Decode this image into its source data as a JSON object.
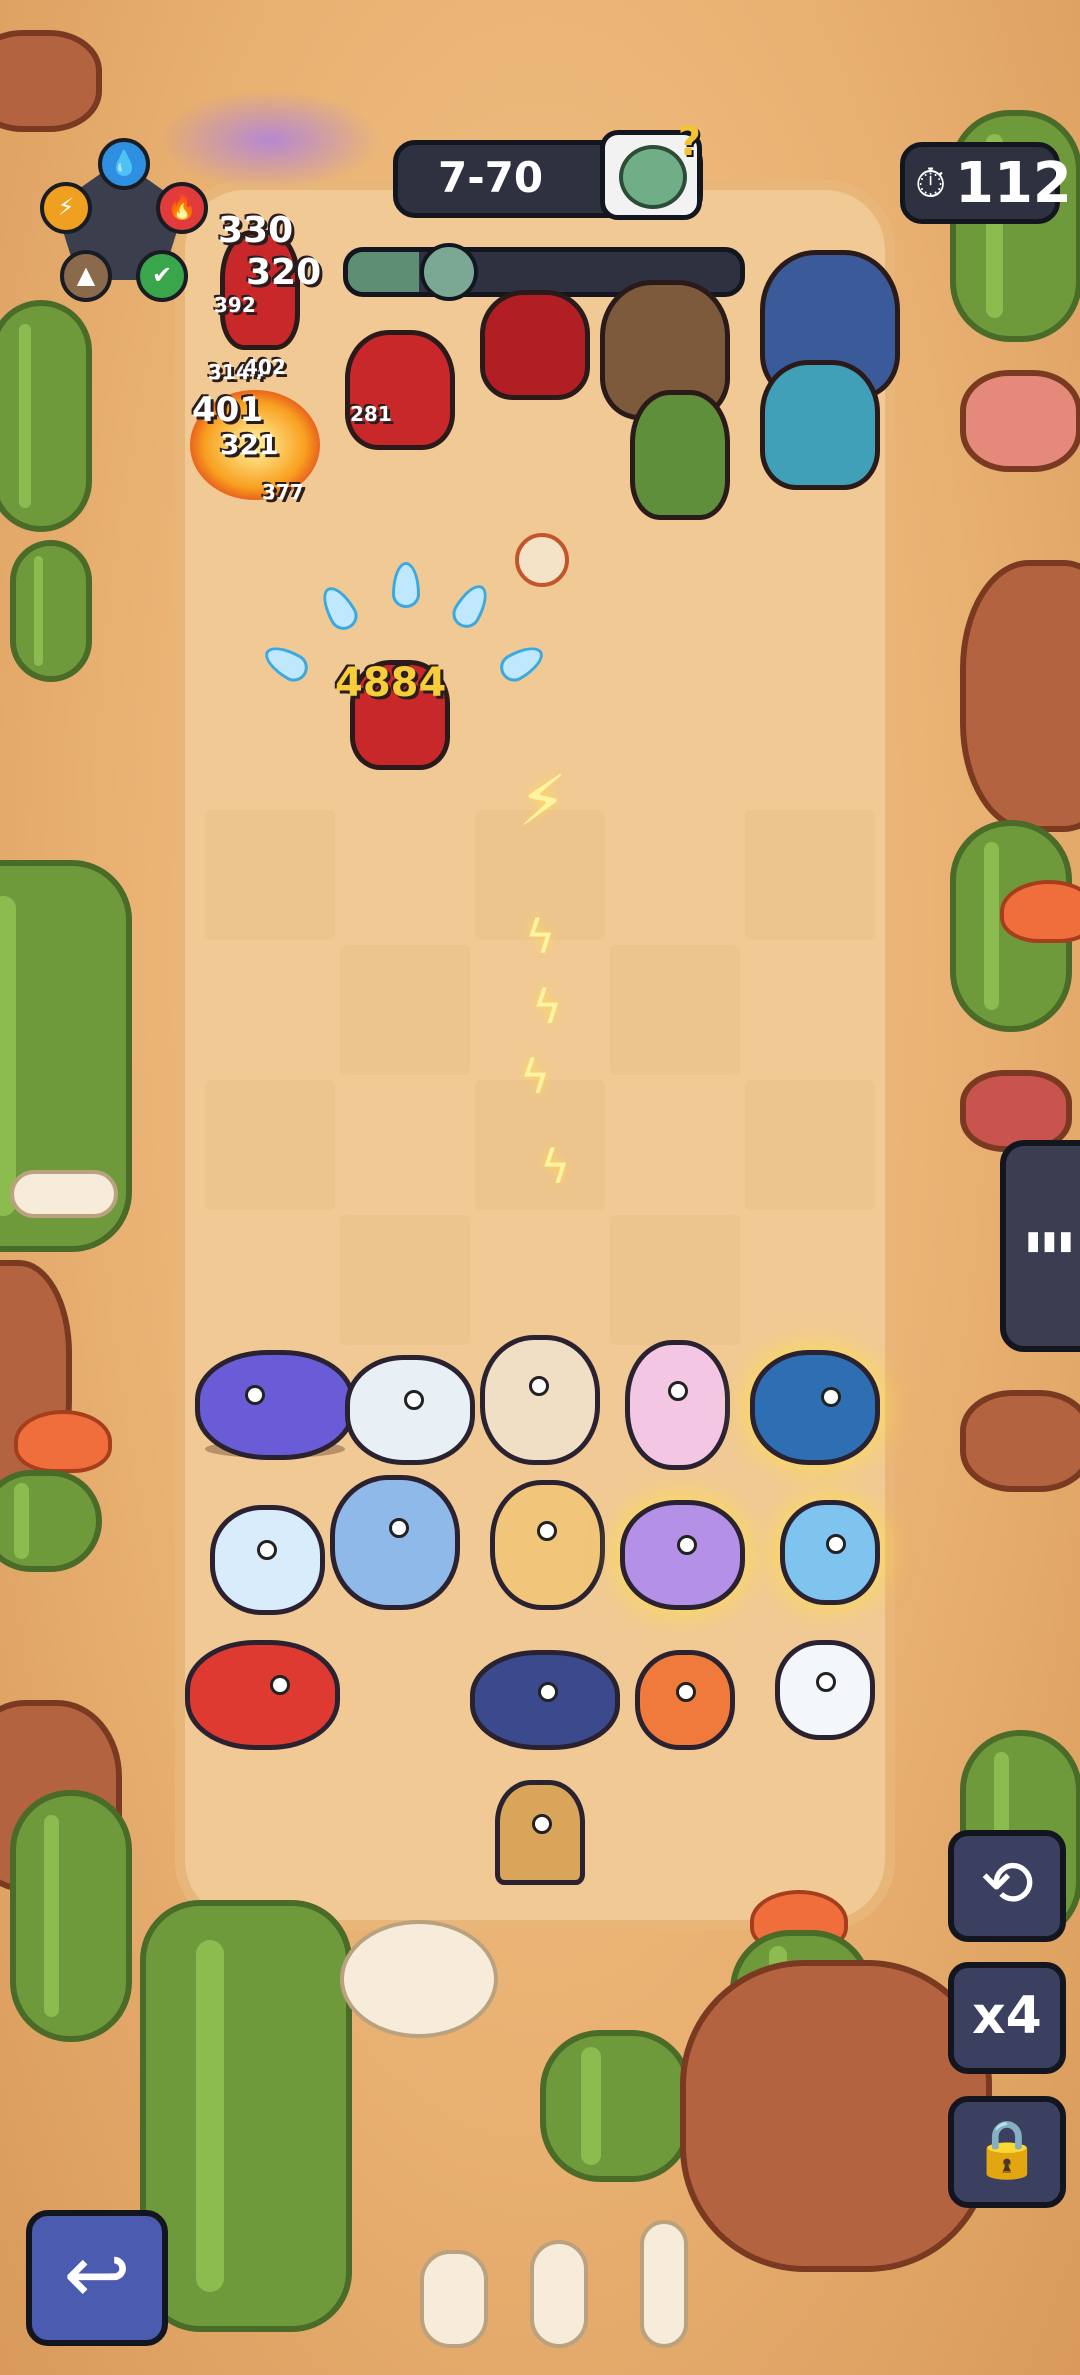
{
  "hud": {
    "stage_label": "7-70",
    "timer_value": "112",
    "wave_progress": 0.18,
    "boss_icon": "zombie-boss-question-icon",
    "timer_icon": "stopwatch-icon"
  },
  "element_wheel": {
    "elements": [
      {
        "name": "water",
        "glyph": "💧",
        "color": "#2f8fe0"
      },
      {
        "name": "fire",
        "glyph": "🔥",
        "color": "#e23b3b"
      },
      {
        "name": "nature",
        "glyph": "✔",
        "color": "#3aa64b"
      },
      {
        "name": "earth",
        "glyph": "▲",
        "color": "#8a6a4a"
      },
      {
        "name": "lightning",
        "glyph": "⚡",
        "color": "#f0a020"
      }
    ]
  },
  "damage_numbers": [
    "330",
    "320",
    "392",
    "3144",
    "402",
    "401",
    "321",
    "377",
    "281",
    "4884"
  ],
  "side_buttons": {
    "refresh_icon": "refresh-icon",
    "speed_label": "x4",
    "lock_icon": "lock-icon",
    "stats_icon": "bar-chart-icon",
    "back_icon": "return-arrow-icon"
  },
  "glyphs": {
    "refresh": "⟲",
    "stats": "▮▮▮",
    "lock": "🔒",
    "back": "↩",
    "stopwatch": "⏱",
    "boss_q": "?",
    "bolt": "⚡",
    "bolt_small": "ϟ"
  }
}
